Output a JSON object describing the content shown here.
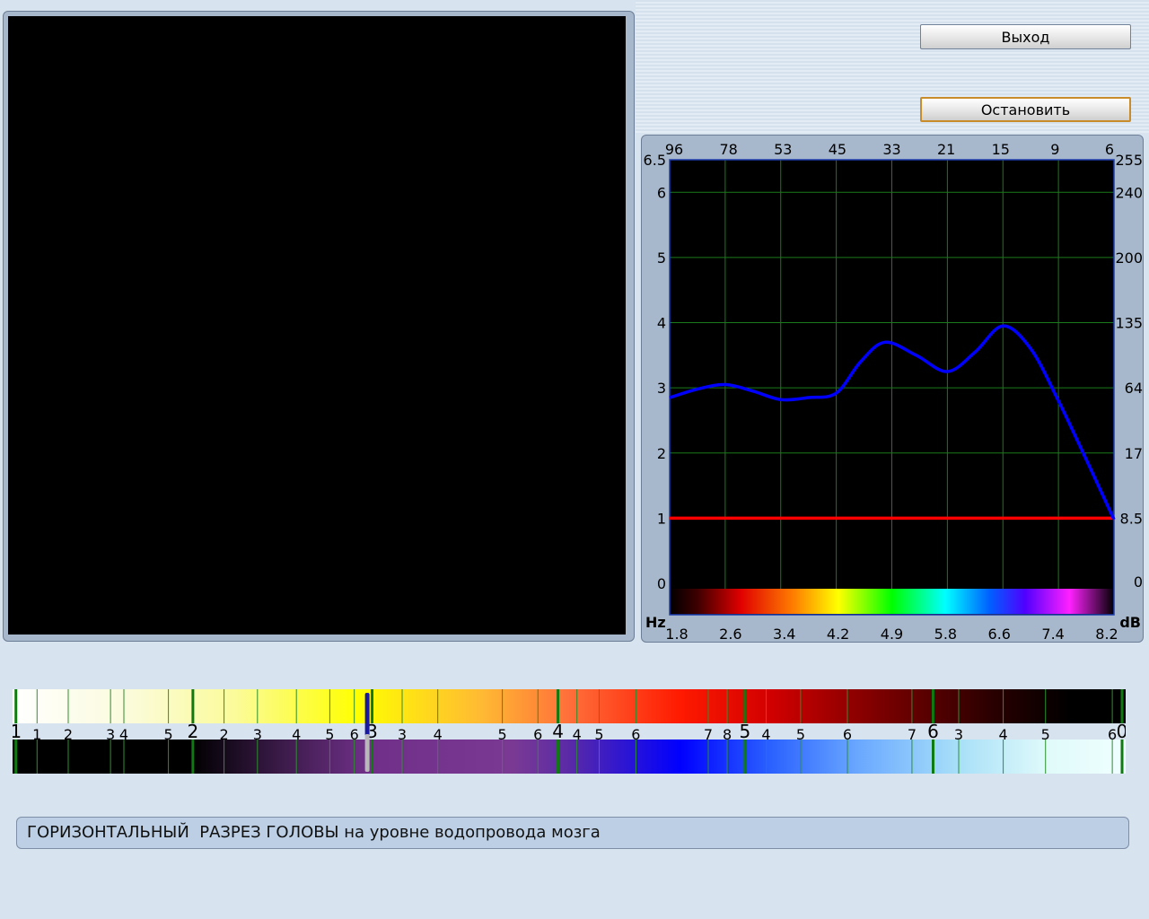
{
  "buttons": {
    "exit_label": "Выход",
    "stop_label": "Остановить"
  },
  "caption": "ГОРИЗОНТАЛЬНЫЙ  РАЗРЕЗ ГОЛОВЫ на уровне водопровода мозга",
  "colors": {
    "curve": "#0000ff",
    "threshold": "#ff0000",
    "grid": "#1b7a1b",
    "plot_bg": "#000000",
    "panel": "#a8b8cc"
  },
  "chart_data": {
    "type": "line",
    "top_ticks": [
      "96",
      "78",
      "53",
      "45",
      "33",
      "21",
      "15",
      "9",
      "6"
    ],
    "bottom_ticks": [
      "1.8",
      "2.6",
      "3.4",
      "4.2",
      "4.9",
      "5.8",
      "6.6",
      "7.4",
      "8.2"
    ],
    "bottom_tick_highlight_index": 7,
    "highlight_color": "#8a1a9a",
    "left_ticks": [
      "0",
      "1",
      "2",
      "3",
      "4",
      "5",
      "6",
      "6.5"
    ],
    "left_tick_values": [
      0,
      1,
      2,
      3,
      4,
      5,
      6,
      6.5
    ],
    "right_ticks": [
      "0",
      "8.5",
      "17",
      "64",
      "135",
      "200",
      "240",
      "255"
    ],
    "right_tick_values": [
      0,
      1,
      2,
      3,
      4,
      5,
      6,
      6.5
    ],
    "xlabel": "Hz",
    "ylabel_right": "dB",
    "xlim": [
      1.8,
      8.2
    ],
    "ylim": [
      0,
      6.5
    ],
    "series": [
      {
        "x": [
          1.8,
          2.2,
          2.6,
          3.0,
          3.4,
          3.8,
          4.2,
          4.55,
          4.9,
          5.35,
          5.8,
          6.2,
          6.6,
          7.0,
          7.4,
          7.8,
          8.2
        ],
        "y": [
          2.85,
          2.98,
          3.05,
          2.95,
          2.82,
          2.85,
          2.92,
          3.4,
          3.7,
          3.5,
          3.25,
          3.55,
          3.95,
          3.6,
          2.8,
          1.9,
          0.98
        ]
      }
    ],
    "threshold_y": 1.0,
    "grid": true
  },
  "scale_bars": {
    "top_labels": [
      {
        "t": "1",
        "p": 0.003,
        "big": true
      },
      {
        "t": "1",
        "p": 0.022
      },
      {
        "t": "2",
        "p": 0.05
      },
      {
        "t": "3",
        "p": 0.088
      },
      {
        "t": "4",
        "p": 0.1
      },
      {
        "t": "5",
        "p": 0.14
      },
      {
        "t": "2",
        "p": 0.162,
        "big": true
      },
      {
        "t": "2",
        "p": 0.19
      },
      {
        "t": "3",
        "p": 0.22
      },
      {
        "t": "4",
        "p": 0.255
      },
      {
        "t": "5",
        "p": 0.285
      },
      {
        "t": "6",
        "p": 0.307
      },
      {
        "t": "3",
        "p": 0.323,
        "big": true
      },
      {
        "t": "3",
        "p": 0.35
      },
      {
        "t": "4",
        "p": 0.382
      },
      {
        "t": "5",
        "p": 0.44
      },
      {
        "t": "6",
        "p": 0.472
      },
      {
        "t": "4",
        "p": 0.49,
        "big": true
      },
      {
        "t": "4",
        "p": 0.507
      },
      {
        "t": "5",
        "p": 0.527
      },
      {
        "t": "6",
        "p": 0.56
      },
      {
        "t": "7",
        "p": 0.625
      },
      {
        "t": "8",
        "p": 0.642
      },
      {
        "t": "5",
        "p": 0.658,
        "big": true
      },
      {
        "t": "4",
        "p": 0.677
      },
      {
        "t": "5",
        "p": 0.708
      },
      {
        "t": "6",
        "p": 0.75
      },
      {
        "t": "7",
        "p": 0.808
      },
      {
        "t": "6",
        "p": 0.827,
        "big": true
      },
      {
        "t": "3",
        "p": 0.85
      },
      {
        "t": "4",
        "p": 0.89
      },
      {
        "t": "5",
        "p": 0.928
      },
      {
        "t": "6",
        "p": 0.988
      },
      {
        "t": "0",
        "p": 1.0,
        "big": true
      }
    ],
    "marker_position": 0.315
  }
}
